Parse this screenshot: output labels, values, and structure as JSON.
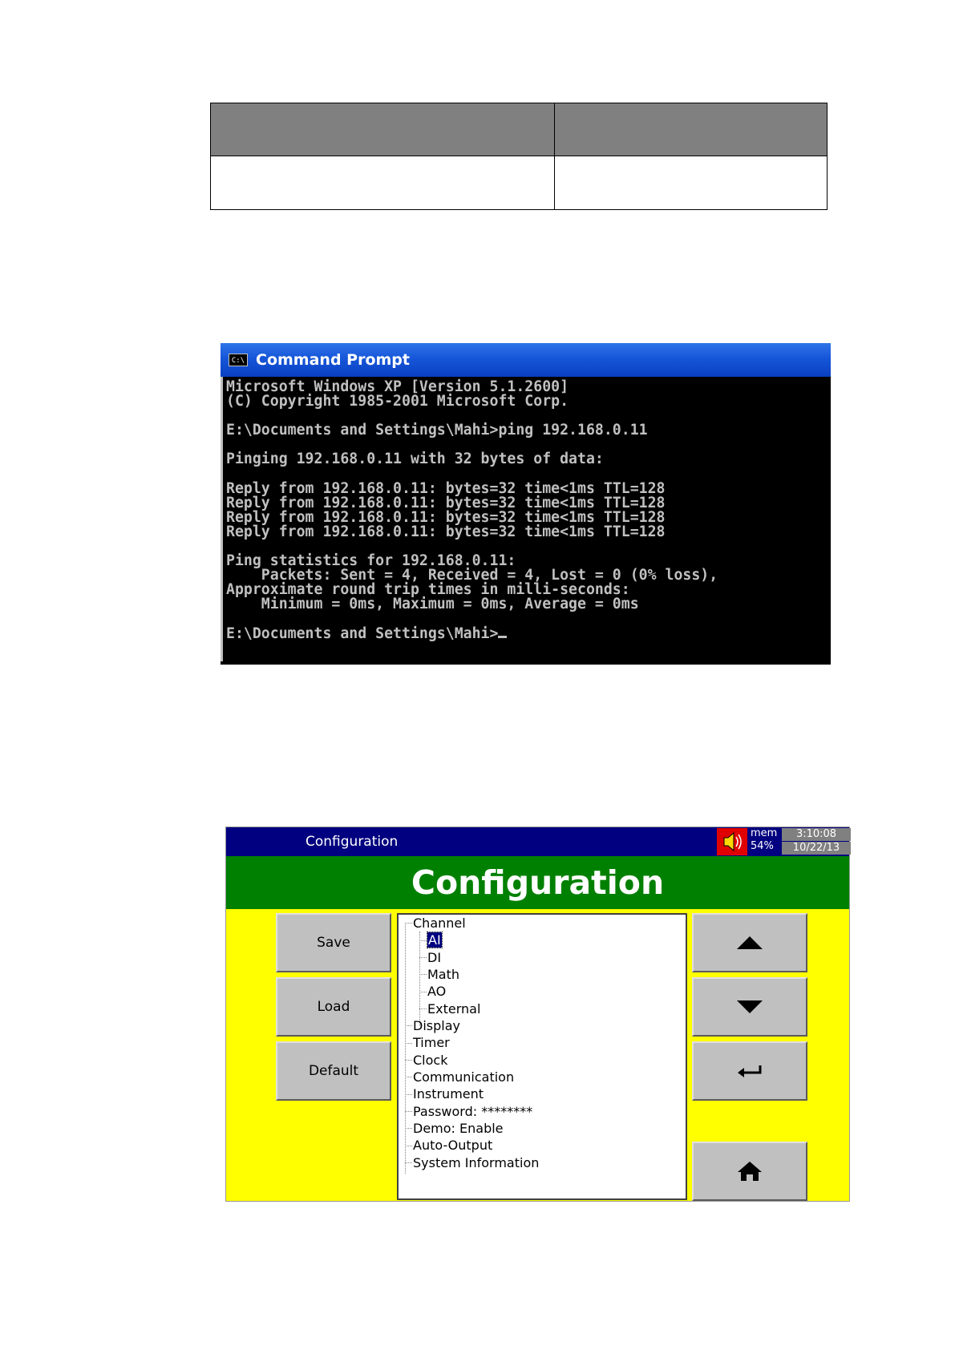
{
  "cmd": {
    "title": "Command Prompt",
    "icon_label": "C:\\",
    "lines": [
      "Microsoft Windows XP [Version 5.1.2600]",
      "(C) Copyright 1985-2001 Microsoft Corp.",
      "",
      "E:\\Documents and Settings\\Mahi>ping 192.168.0.11",
      "",
      "Pinging 192.168.0.11 with 32 bytes of data:",
      "",
      "Reply from 192.168.0.11: bytes=32 time<1ms TTL=128",
      "Reply from 192.168.0.11: bytes=32 time<1ms TTL=128",
      "Reply from 192.168.0.11: bytes=32 time<1ms TTL=128",
      "Reply from 192.168.0.11: bytes=32 time<1ms TTL=128",
      "",
      "Ping statistics for 192.168.0.11:",
      "    Packets: Sent = 4, Received = 4, Lost = 0 (0% loss),",
      "Approximate round trip times in milli-seconds:",
      "    Minimum = 0ms, Maximum = 0ms, Average = 0ms",
      "",
      "E:\\Documents and Settings\\Mahi>"
    ]
  },
  "config": {
    "window_title": "Configuration",
    "header": "Configuration",
    "mem_label": "mem",
    "mem_value": "54%",
    "time": "3:10:08",
    "date": "10/22/13",
    "buttons": {
      "save": "Save",
      "load": "Load",
      "default": "Default"
    },
    "tree": {
      "channel": "Channel",
      "channel_children": [
        "AI",
        "DI",
        "Math",
        "AO",
        "External"
      ],
      "items": [
        "Display",
        "Timer",
        "Clock",
        "Communication",
        "Instrument",
        "Password: ********",
        "Demo: Enable",
        "Auto-Output",
        "System Information"
      ]
    },
    "icons": {
      "up": "up-arrow-icon",
      "down": "down-arrow-icon",
      "enter": "enter-icon",
      "home": "home-icon",
      "speaker": "speaker-mute-icon"
    },
    "colors": {
      "titlebar": "#000080",
      "header": "#008000",
      "background": "#ffff00",
      "button": "#c0c0c0"
    }
  }
}
